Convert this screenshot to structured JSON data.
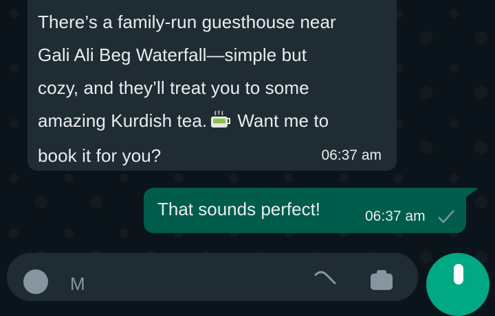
{
  "messages": [
    {
      "direction": "incoming",
      "text_part1": "There’s a family-run guesthouse near\nGali Ali Beg Waterfall—simple but\ncozy, and they’ll treat you to some\namazing Kurdish tea.",
      "emoji": "tea-emoji",
      "text_part2": "Want me to\nbook it for you?",
      "time": "06:37 am"
    },
    {
      "direction": "outgoing",
      "text": "That sounds perfect!",
      "time": "06:37 am",
      "status_icon": "sent-check-icon"
    }
  ],
  "composer": {
    "placeholder": "M",
    "icons": [
      "emoji-icon",
      "attach-icon",
      "camera-icon",
      "mic-icon"
    ]
  },
  "colors": {
    "background": "#0b141a",
    "incoming_bubble": "#202c33",
    "outgoing_bubble": "#005c4b",
    "accent": "#00a884",
    "text": "#e9edef",
    "muted": "#8696a0"
  }
}
